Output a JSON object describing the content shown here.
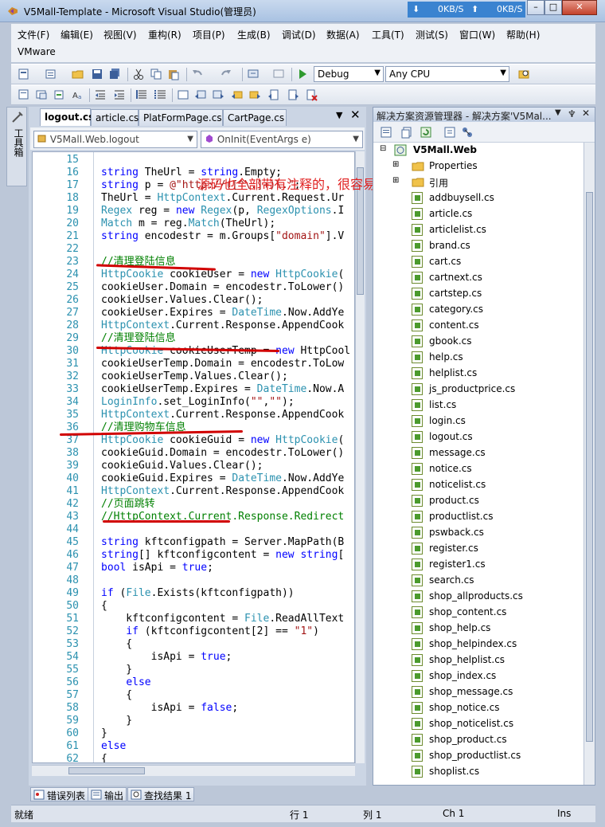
{
  "window": {
    "title": "V5Mall-Template - Microsoft Visual Studio(管理员)",
    "net_down": "0KB/S",
    "net_up": "0KB/S"
  },
  "menu": [
    "文件(F)",
    "编辑(E)",
    "视图(V)",
    "重构(R)",
    "项目(P)",
    "生成(B)",
    "调试(D)",
    "数据(A)",
    "工具(T)",
    "测试(S)",
    "窗口(W)",
    "帮助(H)",
    "VMware"
  ],
  "toolbar": {
    "config": "Debug",
    "platform": "Any CPU"
  },
  "side_toolbox_label": "工具箱",
  "editor": {
    "tabs": [
      "logout.cs",
      "article.cs",
      "PlatFormPage.cs",
      "CartPage.cs"
    ],
    "nav_left": "V5Mall.Web.logout",
    "nav_right": "OnInit(EventArgs e)",
    "annotation": "源码也全部带有注释的，很容易懂",
    "lines": [
      {
        "n": "15",
        "t": ""
      },
      {
        "n": "16",
        "t": "string TheUrl = string.Empty;"
      },
      {
        "n": "17",
        "t": "string p = @\"http://([^\\.]+)\\.\";"
      },
      {
        "n": "18",
        "t": "TheUrl = HttpContext.Current.Request.Ur"
      },
      {
        "n": "19",
        "t": "Regex reg = new Regex(p, RegexOptions.I"
      },
      {
        "n": "20",
        "t": "Match m = reg.Match(TheUrl);"
      },
      {
        "n": "21",
        "t": "string encodestr = m.Groups[\"domain\"].V"
      },
      {
        "n": "22",
        "t": ""
      },
      {
        "n": "23",
        "t": "//清理登陆信息"
      },
      {
        "n": "24",
        "t": "HttpCookie cookieUser = new HttpCookie("
      },
      {
        "n": "25",
        "t": "cookieUser.Domain = encodestr.ToLower()"
      },
      {
        "n": "26",
        "t": "cookieUser.Values.Clear();"
      },
      {
        "n": "27",
        "t": "cookieUser.Expires = DateTime.Now.AddYe"
      },
      {
        "n": "28",
        "t": "HttpContext.Current.Response.AppendCook"
      },
      {
        "n": "29",
        "t": "//清理登陆信息"
      },
      {
        "n": "30",
        "t": "HttpCookie cookieUserTemp = new HttpCool"
      },
      {
        "n": "31",
        "t": "cookieUserTemp.Domain = encodestr.ToLow"
      },
      {
        "n": "32",
        "t": "cookieUserTemp.Values.Clear();"
      },
      {
        "n": "33",
        "t": "cookieUserTemp.Expires = DateTime.Now.A"
      },
      {
        "n": "34",
        "t": "LoginInfo.set_LoginInfo(\"\",\"\");"
      },
      {
        "n": "35",
        "t": "HttpContext.Current.Response.AppendCook"
      },
      {
        "n": "36",
        "t": "//清理购物车信息"
      },
      {
        "n": "37",
        "t": "HttpCookie cookieGuid = new HttpCookie("
      },
      {
        "n": "38",
        "t": "cookieGuid.Domain = encodestr.ToLower()"
      },
      {
        "n": "39",
        "t": "cookieGuid.Values.Clear();"
      },
      {
        "n": "40",
        "t": "cookieGuid.Expires = DateTime.Now.AddYe"
      },
      {
        "n": "41",
        "t": "HttpContext.Current.Response.AppendCook"
      },
      {
        "n": "42",
        "t": "//页面跳转"
      },
      {
        "n": "43",
        "t": "//HttpContext.Current.Response.Redirect"
      },
      {
        "n": "44",
        "t": ""
      },
      {
        "n": "45",
        "t": "string kftconfigpath = Server.MapPath(B"
      },
      {
        "n": "46",
        "t": "string[] kftconfigcontent = new string["
      },
      {
        "n": "47",
        "t": "bool isApi = true;"
      },
      {
        "n": "48",
        "t": ""
      },
      {
        "n": "49",
        "t": "if (File.Exists(kftconfigpath))"
      },
      {
        "n": "50",
        "t": "{"
      },
      {
        "n": "51",
        "t": "    kftconfigcontent = File.ReadAllText"
      },
      {
        "n": "52",
        "t": "    if (kftconfigcontent[2] == \"1\")"
      },
      {
        "n": "53",
        "t": "    {"
      },
      {
        "n": "54",
        "t": "        isApi = true;"
      },
      {
        "n": "55",
        "t": "    }"
      },
      {
        "n": "56",
        "t": "    else"
      },
      {
        "n": "57",
        "t": "    {"
      },
      {
        "n": "58",
        "t": "        isApi = false;"
      },
      {
        "n": "59",
        "t": "    }"
      },
      {
        "n": "60",
        "t": "}"
      },
      {
        "n": "61",
        "t": "else"
      },
      {
        "n": "62",
        "t": "{"
      }
    ]
  },
  "solution": {
    "header": "解决方案资源管理器 - 解决方案'V5Mal...",
    "project": "V5Mall.Web",
    "folders": [
      "Properties",
      "引用"
    ],
    "files": [
      "addbuysell.cs",
      "article.cs",
      "articlelist.cs",
      "brand.cs",
      "cart.cs",
      "cartnext.cs",
      "cartstep.cs",
      "category.cs",
      "content.cs",
      "gbook.cs",
      "help.cs",
      "helplist.cs",
      "js_productprice.cs",
      "list.cs",
      "login.cs",
      "logout.cs",
      "message.cs",
      "notice.cs",
      "noticelist.cs",
      "product.cs",
      "productlist.cs",
      "pswback.cs",
      "register.cs",
      "register1.cs",
      "search.cs",
      "shop_allproducts.cs",
      "shop_content.cs",
      "shop_help.cs",
      "shop_helpindex.cs",
      "shop_helplist.cs",
      "shop_index.cs",
      "shop_message.cs",
      "shop_notice.cs",
      "shop_noticelist.cs",
      "shop_product.cs",
      "shop_productlist.cs",
      "shoplist.cs"
    ]
  },
  "bottom_tabs": [
    "错误列表",
    "输出",
    "查找结果 1"
  ],
  "status": {
    "ready": "就绪",
    "line": "行 1",
    "col": "列 1",
    "ch": "Ch 1",
    "mode": "Ins"
  }
}
